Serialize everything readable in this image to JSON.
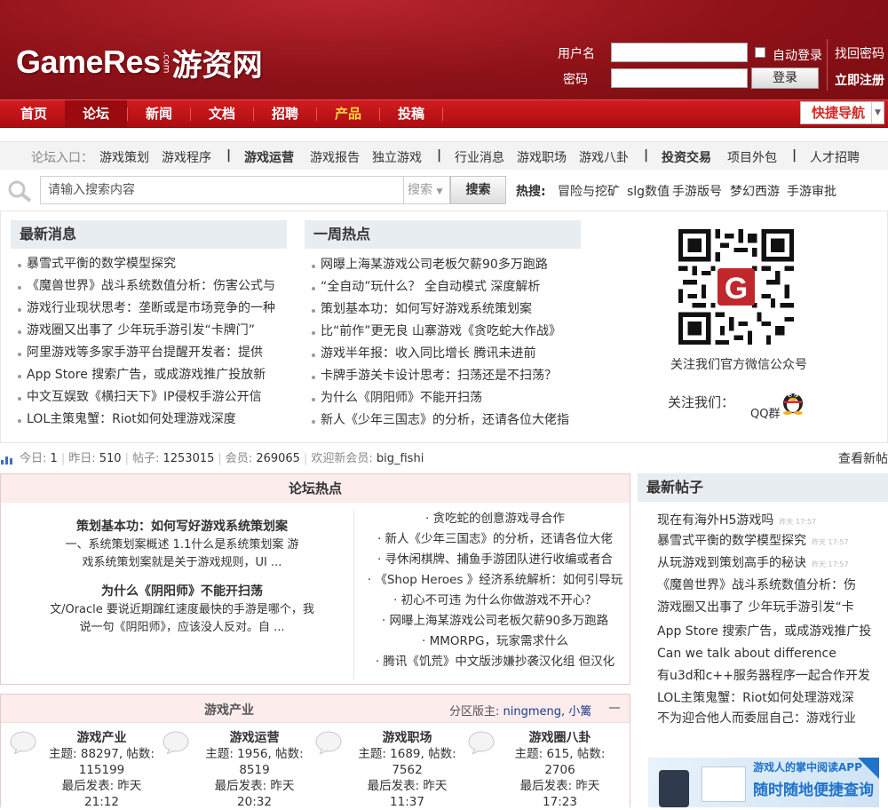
{
  "header": {
    "logo_en": "GameRes",
    "logo_com": ".com",
    "logo_cn": "游资网",
    "username_label": "用户名",
    "password_label": "密码",
    "auto_login": "自动登录",
    "login_button": "登录",
    "forgot_password": "找回密码",
    "register": "立即注册"
  },
  "nav": {
    "items": [
      "首页",
      "论坛",
      "新闻",
      "文档",
      "招聘",
      "产品",
      "投稿"
    ],
    "quick_nav": "快捷导航"
  },
  "forum_entry": {
    "prefix": "论坛入口：",
    "group1": [
      "游戏策划",
      "游戏程序"
    ],
    "group2": [
      "游戏运营",
      "游戏报告",
      "独立游戏"
    ],
    "group3": [
      "行业消息",
      "游戏职场",
      "游戏八卦"
    ],
    "group4": [
      "投资交易",
      "项目外包"
    ],
    "group5": [
      "人才招聘"
    ],
    "divider": "|"
  },
  "search": {
    "placeholder": "请输入搜索内容",
    "select": "搜索",
    "button": "搜索",
    "hot_label": "热搜:",
    "hot_words": [
      "冒险与挖矿",
      "slg数值",
      "手游版号",
      "梦幻西游",
      "手游审批"
    ]
  },
  "latest_news": {
    "title": "最新消息",
    "items": [
      "暴雪式平衡的数学模型探究",
      "《魔兽世界》战斗系统数值分析：伤害公式与",
      "游戏行业现状思考：垄断或是市场竞争的一种",
      "游戏圈又出事了 少年玩手游引发“卡牌门”",
      "阿里游戏等多家手游平台提醒开发者：提供",
      "App Store 搜索广告，或成游戏推广投放新",
      "中文互娱致《横扫天下》IP侵权手游公开信",
      "LOL主策鬼蟹：Riot如何处理游戏深度"
    ]
  },
  "weekly_hot": {
    "title": "一周热点",
    "items": [
      "网曝上海某游戏公司老板欠薪90多万跑路",
      "“全自动”玩什么？ 全自动模式 深度解析",
      "策划基本功：如何写好游戏系统策划案",
      "比“前作”更无良 山寨游戏《贪吃蛇大作战》",
      "游戏半年报：收入同比增长 腾讯未进前",
      "卡牌手游关卡设计思考：扫荡还是不扫荡？",
      "为什么《阴阳师》不能开扫荡",
      "新人《少年三国志》的分析，还请各位大佬指"
    ]
  },
  "wechat": {
    "caption": "关注我们官方微信公众号",
    "follow": "关注我们：",
    "qq_group": "QQ群"
  },
  "stats": {
    "today_label": "今日:",
    "today": "1",
    "yesterday_label": "昨日:",
    "yesterday": "510",
    "posts_label": "帖子:",
    "posts": "1253015",
    "members_label": "会员:",
    "members": "269065",
    "welcome_label": "欢迎新会员:",
    "welcome_user": "big_fishi",
    "view_new": "查看新帖"
  },
  "forum_hot": {
    "title": "论坛热点",
    "featured": [
      {
        "title": "策划基本功：如何写好游戏系统策划案",
        "line1": "一、系统策划案概述 1.1什么是系统策划案 游",
        "line2": "戏系统策划案就是关于游戏规则，UI ..."
      },
      {
        "title": "为什么《阴阳师》不能开扫荡",
        "line1": "文/Oracle 要说近期蹿红速度最快的手游是哪个，我",
        "line2": "说一句《阴阳师》，应该没人反对。自 ..."
      }
    ],
    "list": [
      "· 贪吃蛇的创意游戏寻合作",
      "· 新人《少年三国志》的分析，还请各位大佬",
      "· 寻休闲棋牌、捕鱼手游团队进行收编或者合",
      "· 《Shop Heroes 》经济系统解析：如何引导玩",
      "· 初心不可违 为什么你做游戏不开心？",
      "· 网曝上海某游戏公司老板欠薪90多万跑路",
      "· MMORPG，玩家需求什么",
      "· 腾讯《饥荒》中文版涉嫌抄袭汉化组 但汉化"
    ]
  },
  "new_posts": {
    "title": "最新帖子",
    "time_label": "昨天 17:57",
    "items": [
      "现在有海外H5游戏吗",
      "暴雪式平衡的数学模型探究",
      "从玩游戏到策划高手的秘诀",
      "《魔兽世界》战斗系统数值分析：伤",
      "游戏圈又出事了 少年玩手游引发“卡",
      "App Store 搜索广告，或成游戏推广投",
      "Can we talk about difference",
      "有u3d和c++服务器程序一起合作开发",
      "LOL主策鬼蟹：Riot如何处理游戏深",
      "不为迎合他人而委屈自己：游戏行业"
    ]
  },
  "industry": {
    "title": "游戏产业",
    "moderator_label": "分区版主:",
    "moderators": "ningmeng, 小篱",
    "boards": [
      {
        "name": "游戏产业",
        "stats": "主题: 88297, 帖数: 115199",
        "last": "最后发表: 昨天 21:12"
      },
      {
        "name": "游戏运营",
        "stats": "主题: 1956, 帖数: 8519",
        "last": "最后发表: 昨天 20:32"
      },
      {
        "name": "游戏职场",
        "stats": "主题: 1689, 帖数: 7562",
        "last": "最后发表: 昨天 11:37"
      },
      {
        "name": "游戏圈八卦",
        "stats": "主题: 615, 帖数: 2706",
        "last": "最后发表: 昨天 17:23"
      }
    ]
  },
  "ad": {
    "line1": "游戏人的掌中阅读APP",
    "line2": "随时随地便捷查询"
  },
  "colors": {
    "brand_red": "#b3141a",
    "accent_gold": "#ffd83b",
    "link_blue": "#1a3c8b"
  }
}
